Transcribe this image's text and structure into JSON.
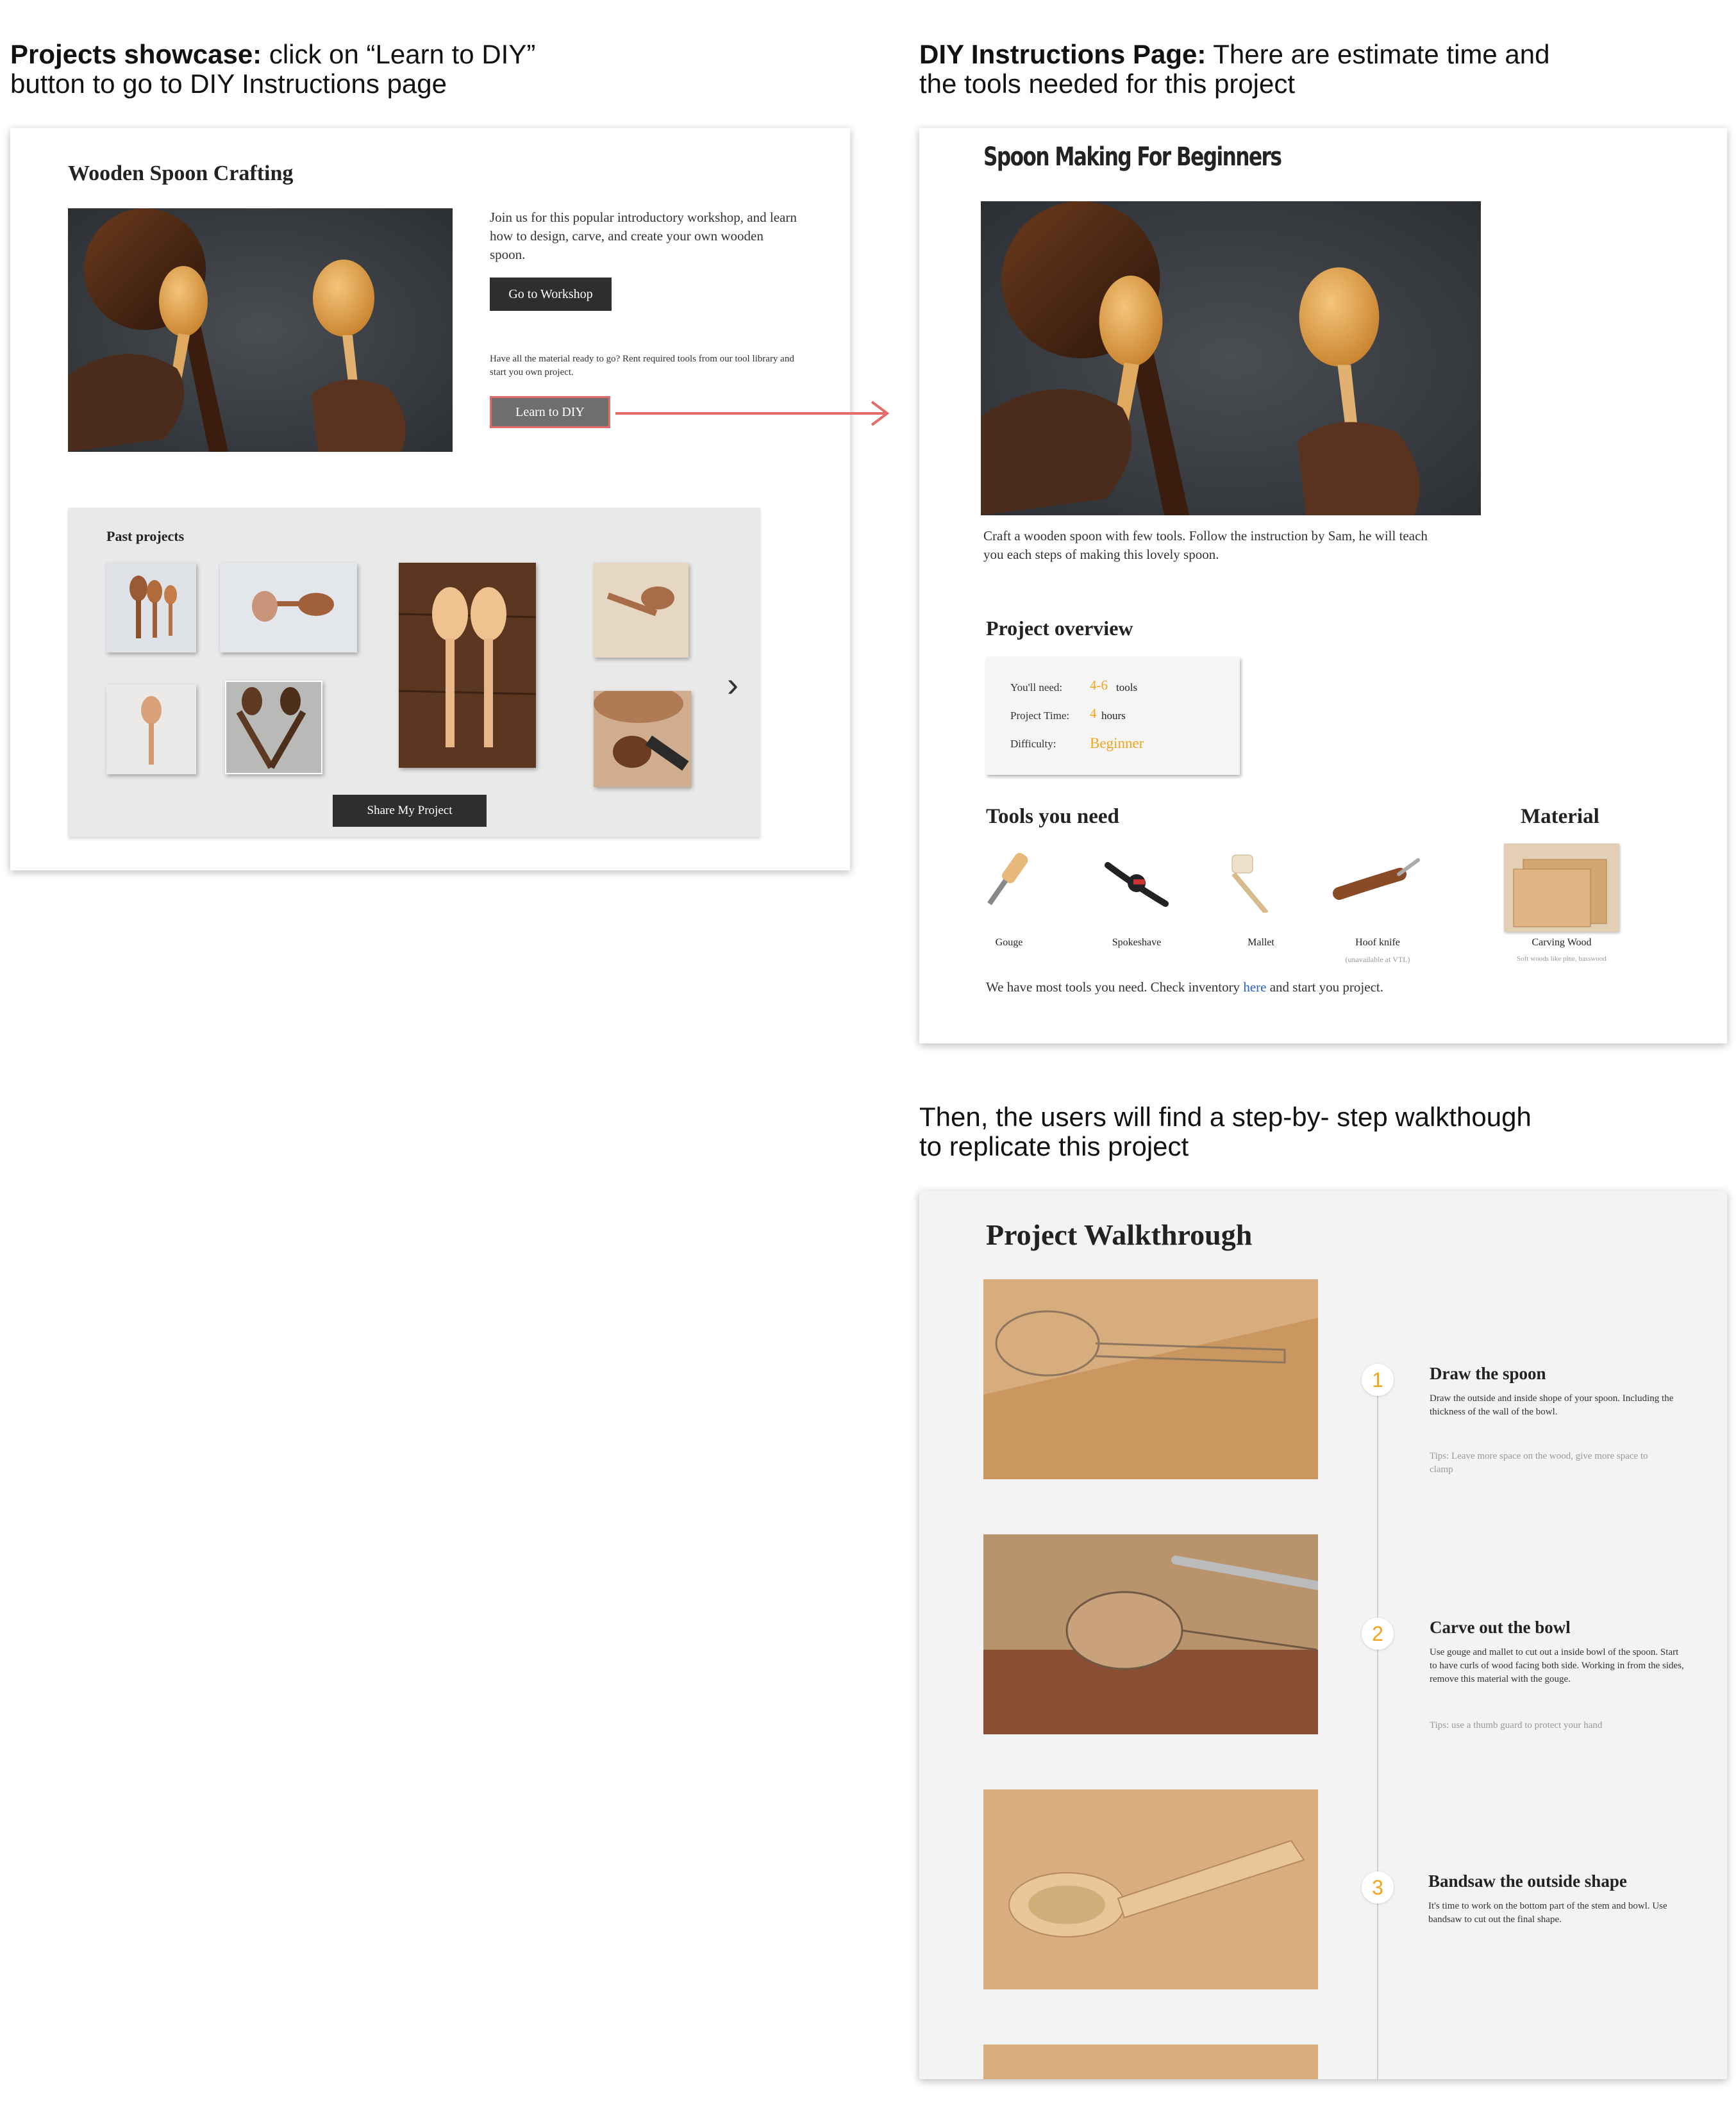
{
  "captions": {
    "showcase_title": "Projects showcase:",
    "showcase_text_1": " click on “Learn to DIY”",
    "showcase_text_2": "button to go to DIY Instructions page",
    "diy_title": "DIY Instructions Page:",
    "diy_text_1": " There are estimate time and",
    "diy_text_2": "the tools needed for this project",
    "walk_text_1": "Then, the users will find a step-by- step walkthough",
    "walk_text_2": "to replicate this project"
  },
  "showcase": {
    "title": "Wooden Spoon Crafting",
    "intro": "Join us for this popular introductory workshop, and learn how to design, carve, and create your own wooden spoon.",
    "workshop_button": "Go to Workshop",
    "material_text": "Have all the material ready to go? Rent required tools from our tool library and start you own project.",
    "diy_button": "Learn to DIY",
    "past_projects_title": "Past projects",
    "share_button": "Share My Project"
  },
  "diy": {
    "title": "Spoon Making For Beginners",
    "caption": "Craft a wooden spoon with few tools. Follow the instruction by Sam, he will teach you each steps of making this lovely spoon.",
    "overview_title": "Project overview",
    "need_label": "You'll need:",
    "need_value": "4-6",
    "need_unit": "tools",
    "time_label": "Project Time:",
    "time_value": "4",
    "time_unit": "hours",
    "difficulty_label": "Difficulty:",
    "difficulty_value": "Beginner",
    "tools_title": "Tools you need",
    "material_title": "Material",
    "tools": [
      {
        "name": "Gouge",
        "note": ""
      },
      {
        "name": "Spokeshave",
        "note": ""
      },
      {
        "name": "Mallet",
        "note": ""
      },
      {
        "name": "Hoof knife",
        "note": "(unavailable at VTL)"
      }
    ],
    "material_name": "Carving Wood",
    "material_note": "Soft woods like pine, basswood",
    "inventory_before": "We have most tools you need. Check inventory ",
    "inventory_link": "here",
    "inventory_after": " and start you project."
  },
  "walkthrough": {
    "title": "Project Walkthrough",
    "steps": [
      {
        "num": "1",
        "title": "Draw the spoon",
        "body": "Draw the outside and inside shope of your spoon. Including the thickness of the wall of the bowl.",
        "tip": "Tips: Leave more space on the wood, give more space to clamp"
      },
      {
        "num": "2",
        "title": "Carve out the bowl",
        "body": "Use gouge and mallet to cut out a inside bowl of the spoon. Start to have curls of wood facing both side. Working in from the sides, remove this material with the gouge.",
        "tip": "Tips: use a thumb guard to protect your hand"
      },
      {
        "num": "3",
        "title": "Bandsaw the outside shape",
        "body": "It's time to work on the bottom part of the stem and bowl. Use bandsaw to cut out the final shape.",
        "tip": ""
      }
    ]
  },
  "colors": {
    "accent_orange": "#f2a41b",
    "arrow_red": "#e46a6a",
    "link_blue": "#2a5bd7",
    "dark_button": "#2e2e2e"
  }
}
